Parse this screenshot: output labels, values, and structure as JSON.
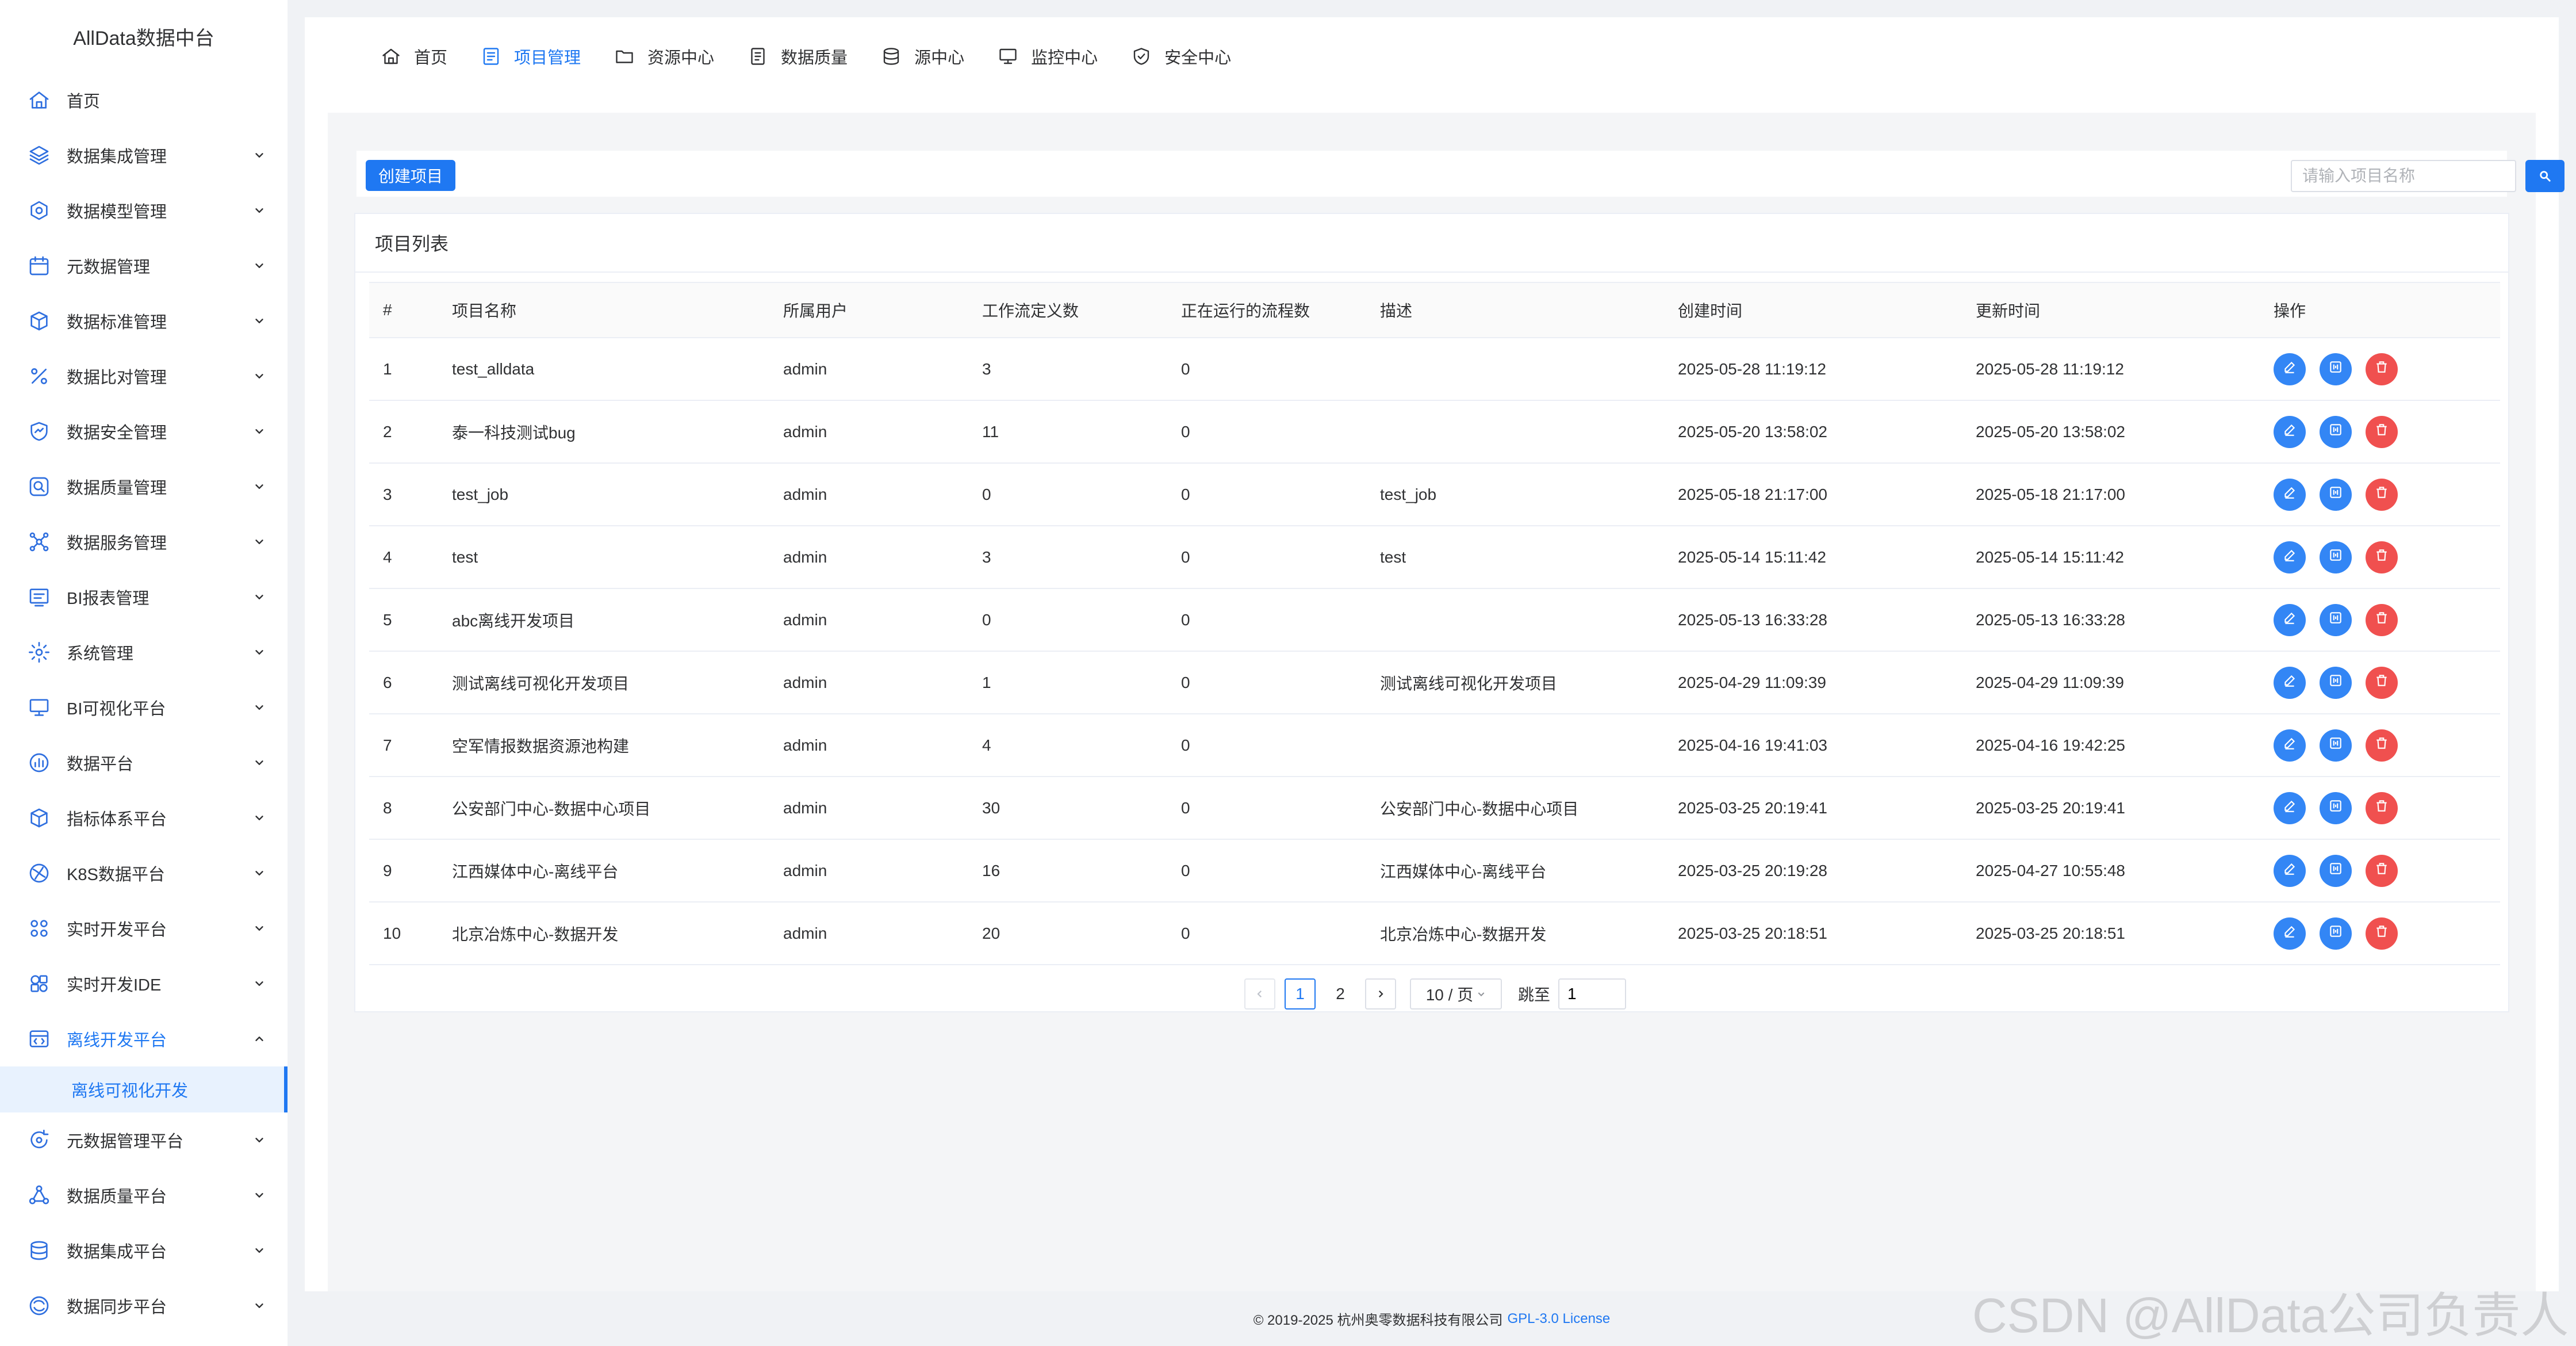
{
  "app": {
    "title": "AllData数据中台"
  },
  "sidebar": {
    "items": [
      {
        "label": "首页",
        "icon": "home-icon",
        "has_children": false
      },
      {
        "label": "数据集成管理",
        "icon": "layers-icon",
        "has_children": true
      },
      {
        "label": "数据模型管理",
        "icon": "model-icon",
        "has_children": true
      },
      {
        "label": "元数据管理",
        "icon": "calendar-icon",
        "has_children": true
      },
      {
        "label": "数据标准管理",
        "icon": "cube-icon",
        "has_children": true
      },
      {
        "label": "数据比对管理",
        "icon": "percent-icon",
        "has_children": true
      },
      {
        "label": "数据安全管理",
        "icon": "shield-icon",
        "has_children": true
      },
      {
        "label": "数据质量管理",
        "icon": "quality-search-icon",
        "has_children": true
      },
      {
        "label": "数据服务管理",
        "icon": "service-icon",
        "has_children": true
      },
      {
        "label": "BI报表管理",
        "icon": "report-icon",
        "has_children": true
      },
      {
        "label": "系统管理",
        "icon": "gear-icon",
        "has_children": true
      },
      {
        "label": "BI可视化平台",
        "icon": "monitor-icon",
        "has_children": true
      },
      {
        "label": "数据平台",
        "icon": "chart-icon",
        "has_children": true
      },
      {
        "label": "指标体系平台",
        "icon": "cube-icon",
        "has_children": true
      },
      {
        "label": "K8S数据平台",
        "icon": "k8s-icon",
        "has_children": true
      },
      {
        "label": "实时开发平台",
        "icon": "grid-icon",
        "has_children": true
      },
      {
        "label": "实时开发IDE",
        "icon": "ide-icon",
        "has_children": true
      },
      {
        "label": "离线开发平台",
        "icon": "offline-icon",
        "has_children": true,
        "open": true
      }
    ],
    "active_sub": {
      "label": "离线可视化开发"
    },
    "items_after": [
      {
        "label": "元数据管理平台",
        "icon": "refresh-icon",
        "has_children": true
      },
      {
        "label": "数据质量平台",
        "icon": "network-icon",
        "has_children": true
      },
      {
        "label": "数据集成平台",
        "icon": "database-icon",
        "has_children": true
      },
      {
        "label": "数据同步平台",
        "icon": "sync-icon",
        "has_children": true
      }
    ]
  },
  "topnav": {
    "tabs": [
      {
        "label": "首页",
        "icon": "home-icon",
        "active": false
      },
      {
        "label": "项目管理",
        "icon": "list-icon",
        "active": true
      },
      {
        "label": "资源中心",
        "icon": "folder-icon",
        "active": false
      },
      {
        "label": "数据质量",
        "icon": "document-icon",
        "active": false
      },
      {
        "label": "源中心",
        "icon": "database-icon",
        "active": false
      },
      {
        "label": "监控中心",
        "icon": "monitor-icon",
        "active": false
      },
      {
        "label": "安全中心",
        "icon": "shield-check-icon",
        "active": false
      }
    ]
  },
  "toolbar": {
    "create_label": "创建项目",
    "search_placeholder": "请输入项目名称"
  },
  "card": {
    "title": "项目列表"
  },
  "table": {
    "columns": [
      "#",
      "项目名称",
      "所属用户",
      "工作流定义数",
      "正在运行的流程数",
      "描述",
      "创建时间",
      "更新时间",
      "操作"
    ],
    "rows": [
      {
        "index": "1",
        "name": "test_alldata",
        "user": "admin",
        "workflows": "3",
        "running": "0",
        "desc": "",
        "created": "2025-05-28 11:19:12",
        "updated": "2025-05-28 11:19:12"
      },
      {
        "index": "2",
        "name": "泰一科技测试bug",
        "user": "admin",
        "workflows": "11",
        "running": "0",
        "desc": "",
        "created": "2025-05-20 13:58:02",
        "updated": "2025-05-20 13:58:02"
      },
      {
        "index": "3",
        "name": "test_job",
        "user": "admin",
        "workflows": "0",
        "running": "0",
        "desc": "test_job",
        "created": "2025-05-18 21:17:00",
        "updated": "2025-05-18 21:17:00"
      },
      {
        "index": "4",
        "name": "test",
        "user": "admin",
        "workflows": "3",
        "running": "0",
        "desc": "test",
        "created": "2025-05-14 15:11:42",
        "updated": "2025-05-14 15:11:42"
      },
      {
        "index": "5",
        "name": "abc离线开发项目",
        "user": "admin",
        "workflows": "0",
        "running": "0",
        "desc": "",
        "created": "2025-05-13 16:33:28",
        "updated": "2025-05-13 16:33:28"
      },
      {
        "index": "6",
        "name": "测试离线可视化开发项目",
        "user": "admin",
        "workflows": "1",
        "running": "0",
        "desc": "测试离线可视化开发项目",
        "created": "2025-04-29 11:09:39",
        "updated": "2025-04-29 11:09:39"
      },
      {
        "index": "7",
        "name": "空军情报数据资源池构建",
        "user": "admin",
        "workflows": "4",
        "running": "0",
        "desc": "",
        "created": "2025-04-16 19:41:03",
        "updated": "2025-04-16 19:42:25"
      },
      {
        "index": "8",
        "name": "公安部门中心-数据中心项目",
        "user": "admin",
        "workflows": "30",
        "running": "0",
        "desc": "公安部门中心-数据中心项目",
        "created": "2025-03-25 20:19:41",
        "updated": "2025-03-25 20:19:41"
      },
      {
        "index": "9",
        "name": "江西媒体中心-离线平台",
        "user": "admin",
        "workflows": "16",
        "running": "0",
        "desc": "江西媒体中心-离线平台",
        "created": "2025-03-25 20:19:28",
        "updated": "2025-04-27 10:55:48"
      },
      {
        "index": "10",
        "name": "北京冶炼中心-数据开发",
        "user": "admin",
        "workflows": "20",
        "running": "0",
        "desc": "北京冶炼中心-数据开发",
        "created": "2025-03-25 20:18:51",
        "updated": "2025-03-25 20:18:51"
      }
    ]
  },
  "pagination": {
    "pages": [
      "1",
      "2"
    ],
    "current": "1",
    "page_size": "10 / 页",
    "jump_label": "跳至",
    "jump_value": "1"
  },
  "footer": {
    "copyright": "© 2019-2025 杭州奥零数据科技有限公司",
    "license": "GPL-3.0 License"
  },
  "watermark": "CSDN @AllData公司负责人",
  "colors": {
    "accent": "#1f78f2",
    "danger": "#f0504f",
    "sidebar_bg": "#ffffff",
    "page_bg": "#f0f2f5"
  }
}
